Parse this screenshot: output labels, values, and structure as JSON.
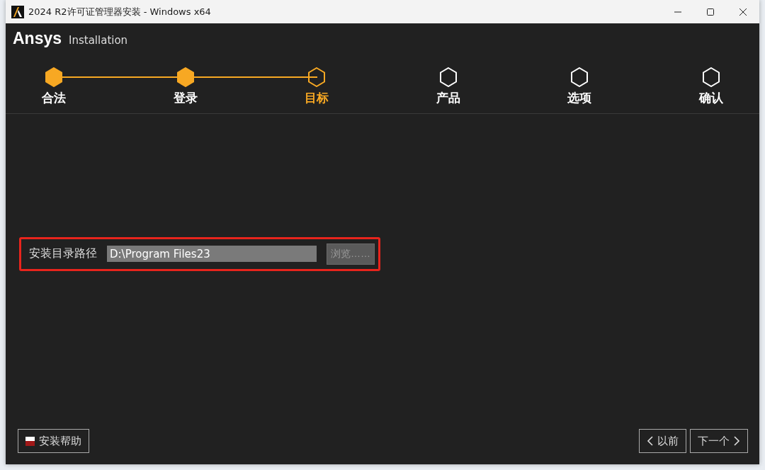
{
  "window": {
    "title": "2024 R2许可证管理器安装 - Windows x64"
  },
  "header": {
    "brand": "Ansys",
    "subtitle": "Installation"
  },
  "steps": [
    {
      "label": "合法",
      "completed": true,
      "selected": false
    },
    {
      "label": "登录",
      "completed": true,
      "selected": false
    },
    {
      "label": "目标",
      "completed": false,
      "selected": true
    },
    {
      "label": "产品",
      "completed": false,
      "selected": false
    },
    {
      "label": "选项",
      "completed": false,
      "selected": false
    },
    {
      "label": "确认",
      "completed": false,
      "selected": false
    }
  ],
  "path_row": {
    "label": "安装目录路径",
    "value": "D:\\Program Files23",
    "browse": {
      "label": "浏览……",
      "disabled": true
    },
    "highlighted": true
  },
  "footer": {
    "help": "安装帮助",
    "back": "以前",
    "next": "下一个"
  }
}
